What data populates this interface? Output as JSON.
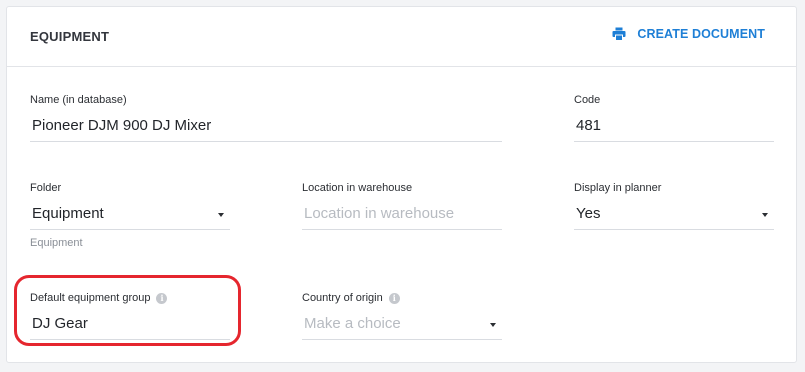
{
  "header": {
    "title": "EQUIPMENT",
    "create_document_label": "CREATE DOCUMENT"
  },
  "fields": {
    "name": {
      "label": "Name (in database)",
      "value": "Pioneer DJM 900 DJ Mixer"
    },
    "code": {
      "label": "Code",
      "value": "481"
    },
    "folder": {
      "label": "Folder",
      "value": "Equipment",
      "helper": "Equipment"
    },
    "location": {
      "label": "Location in warehouse",
      "placeholder": "Location in warehouse"
    },
    "display_in_planner": {
      "label": "Display in planner",
      "value": "Yes"
    },
    "default_group": {
      "label": "Default equipment group",
      "value": "DJ Gear"
    },
    "country": {
      "label": "Country of origin",
      "placeholder": "Make a choice"
    }
  },
  "colors": {
    "accent": "#1e7fd6",
    "highlight": "#e5262e"
  },
  "icons": {
    "create_document": "printer-icon",
    "info": "info-icon",
    "dropdown": "caret-down-icon"
  }
}
